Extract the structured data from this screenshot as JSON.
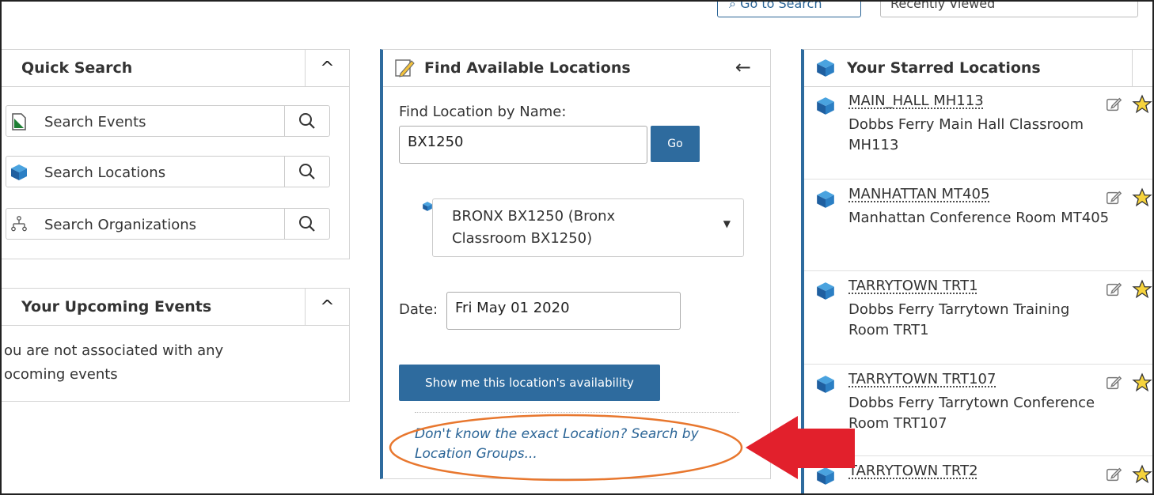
{
  "toolbar": {
    "go_to_search": "Go to Search",
    "view_select": "Recently Viewed"
  },
  "quick_search": {
    "title": "Quick Search",
    "items": [
      {
        "label": "Search Events",
        "icon": "events-icon"
      },
      {
        "label": "Search Locations",
        "icon": "location-cube-icon"
      },
      {
        "label": "Search Organizations",
        "icon": "organization-icon"
      }
    ]
  },
  "upcoming": {
    "title": "Your Upcoming Events",
    "message_line1": "ou are not associated with any",
    "message_line2": "ocoming events"
  },
  "find_locations": {
    "title": "Find Available Locations",
    "name_label": "Find Location by Name:",
    "name_value": "BX1250",
    "go_label": "Go",
    "selected_line1": "BRONX BX1250 (Bronx",
    "selected_line2": "Classroom BX1250)",
    "date_label": "Date:",
    "date_value": "Fri May 01 2020",
    "availability_button": "Show me this location's availability",
    "groups_link_line1": "Don't know the exact Location? Search by",
    "groups_link_line2": "Location Groups..."
  },
  "starred": {
    "title": "Your Starred Locations",
    "items": [
      {
        "name": "MAIN_HALL MH113",
        "desc": "Dobbs Ferry Main Hall Classroom MH113"
      },
      {
        "name": "MANHATTAN MT405",
        "desc": "Manhattan Conference Room MT405"
      },
      {
        "name": "TARRYTOWN TRT1",
        "desc": "Dobbs Ferry Tarrytown Training Room TRT1"
      },
      {
        "name": "TARRYTOWN TRT107",
        "desc": "Dobbs Ferry Tarrytown Conference Room TRT107"
      },
      {
        "name": "TARRYTOWN TRT2",
        "desc": ""
      }
    ]
  },
  "colors": {
    "accent_blue": "#2e6b9e",
    "annotation_red": "#e2202c",
    "annotation_orange": "#e8772e"
  }
}
